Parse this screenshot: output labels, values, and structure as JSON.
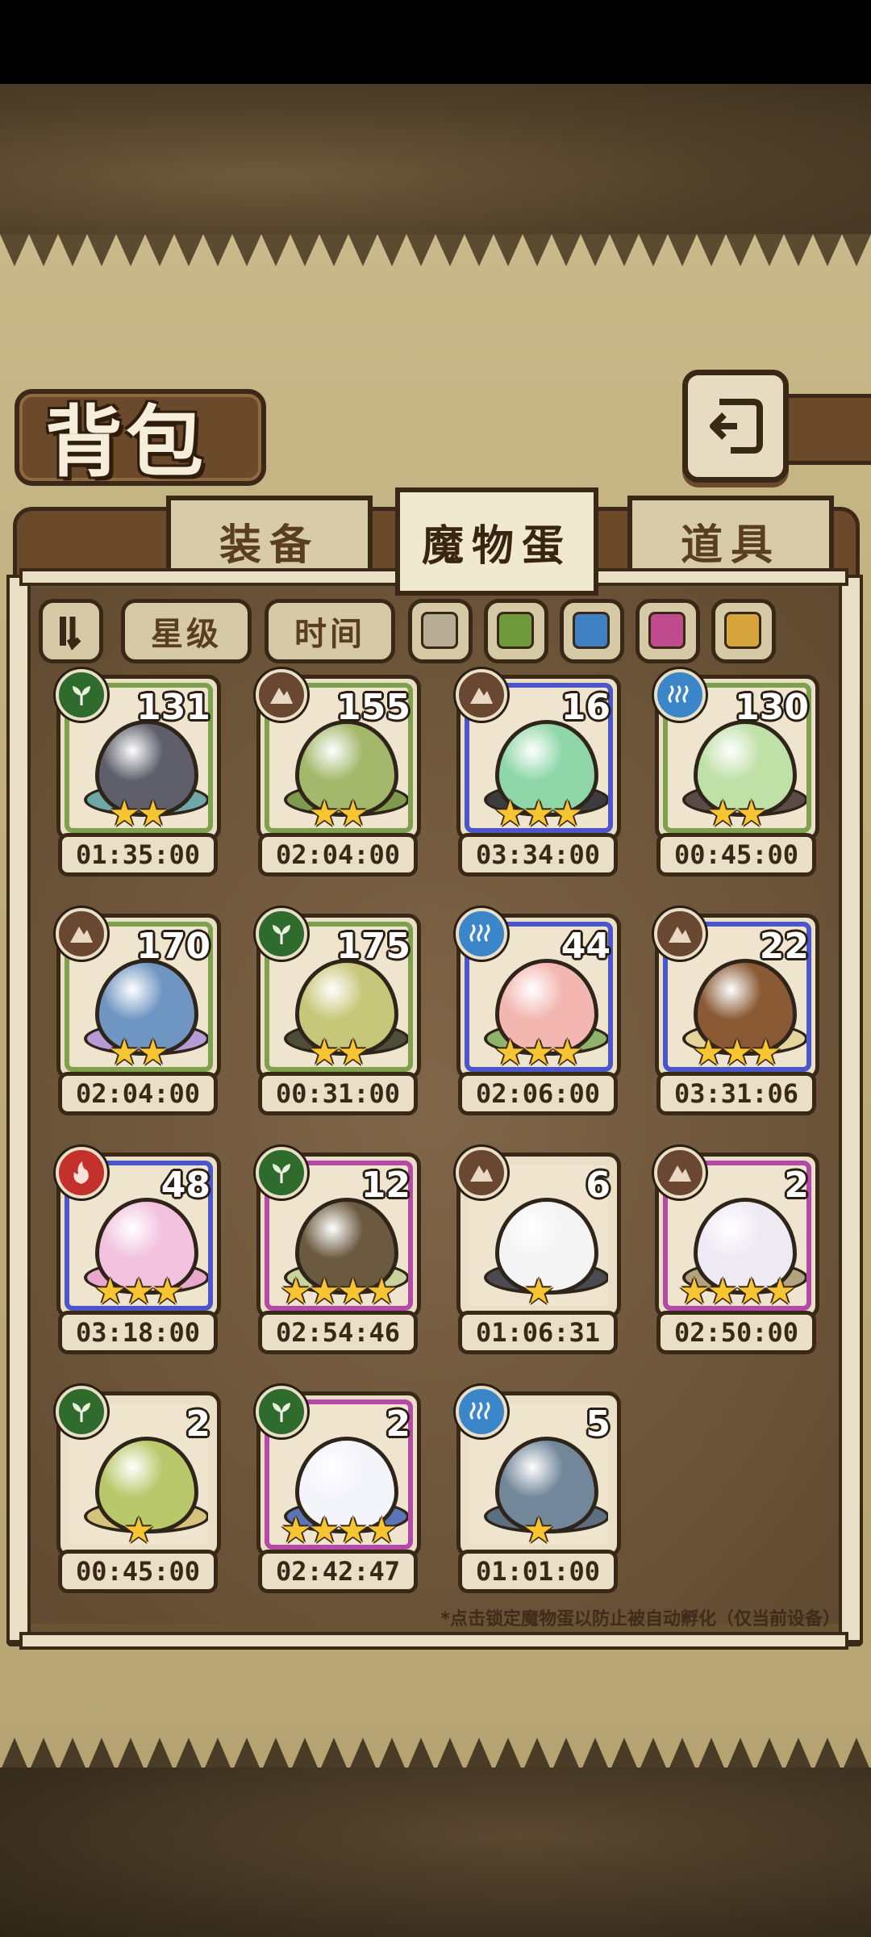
{
  "header": {
    "title": "背包"
  },
  "tabs": [
    {
      "label": "装备",
      "active": false
    },
    {
      "label": "魔物蛋",
      "active": true
    },
    {
      "label": "道具",
      "active": false
    }
  ],
  "filters": {
    "sort_icon": "sort-order-icon",
    "star_label": "星级",
    "time_label": "时间",
    "colors": [
      "#b7ad95",
      "#6e9a3c",
      "#3f7fc4",
      "#c04a8e",
      "#d6a53c"
    ]
  },
  "eggs": [
    {
      "count": "131",
      "time": "01:35:00",
      "element": "plant",
      "stars": 2,
      "frame": "green",
      "egg_color": "#5e5f6a",
      "base_color": "#6fa6a8"
    },
    {
      "count": "155",
      "time": "02:04:00",
      "element": "earth",
      "stars": 2,
      "frame": "green",
      "egg_color": "#a4b86c",
      "base_color": "#7f9a4e"
    },
    {
      "count": "16",
      "time": "03:34:00",
      "element": "earth",
      "stars": 3,
      "frame": "blue",
      "egg_color": "#8fd7a8",
      "base_color": "#3c3c40"
    },
    {
      "count": "130",
      "time": "00:45:00",
      "element": "water",
      "stars": 2,
      "frame": "green",
      "egg_color": "#bfe0a6",
      "base_color": "#5a4c46"
    },
    {
      "count": "170",
      "time": "02:04:00",
      "element": "earth",
      "stars": 2,
      "frame": "green",
      "egg_color": "#6f95c2",
      "base_color": "#b79ad8"
    },
    {
      "count": "175",
      "time": "00:31:00",
      "element": "plant",
      "stars": 2,
      "frame": "green",
      "egg_color": "#c7c77a",
      "base_color": "#4d4d3a"
    },
    {
      "count": "44",
      "time": "02:06:00",
      "element": "water",
      "stars": 3,
      "frame": "blue",
      "egg_color": "#f3b6b0",
      "base_color": "#8fb36a"
    },
    {
      "count": "22",
      "time": "03:31:06",
      "element": "earth",
      "stars": 3,
      "frame": "blue",
      "egg_color": "#8a5a34",
      "base_color": "#e5d59a"
    },
    {
      "count": "48",
      "time": "03:18:00",
      "element": "fire",
      "stars": 3,
      "frame": "blue",
      "egg_color": "#f2c2de",
      "base_color": "#e7a8cc"
    },
    {
      "count": "12",
      "time": "02:54:46",
      "element": "plant",
      "stars": 4,
      "frame": "purple",
      "egg_color": "#6b5a3f",
      "base_color": "#c9d39b"
    },
    {
      "count": "6",
      "time": "01:06:31",
      "element": "earth",
      "stars": 1,
      "frame": "plain",
      "egg_color": "#f4f4f4",
      "base_color": "#4a4a52"
    },
    {
      "count": "2",
      "time": "02:50:00",
      "element": "earth",
      "stars": 4,
      "frame": "purple",
      "egg_color": "#eeeaf4",
      "base_color": "#b3a27c"
    },
    {
      "count": "2",
      "time": "00:45:00",
      "element": "plant",
      "stars": 1,
      "frame": "plain",
      "egg_color": "#b9c86a",
      "base_color": "#d6c27a"
    },
    {
      "count": "2",
      "time": "02:42:47",
      "element": "plant",
      "stars": 4,
      "frame": "purple",
      "egg_color": "#f4f4fb",
      "base_color": "#5b74b6"
    },
    {
      "count": "5",
      "time": "01:01:00",
      "element": "water",
      "stars": 1,
      "frame": "plain",
      "egg_color": "#72879a",
      "base_color": "#5b6f80"
    }
  ],
  "hint": "*点击锁定魔物蛋以防止被自动孵化（仅当前设备）"
}
